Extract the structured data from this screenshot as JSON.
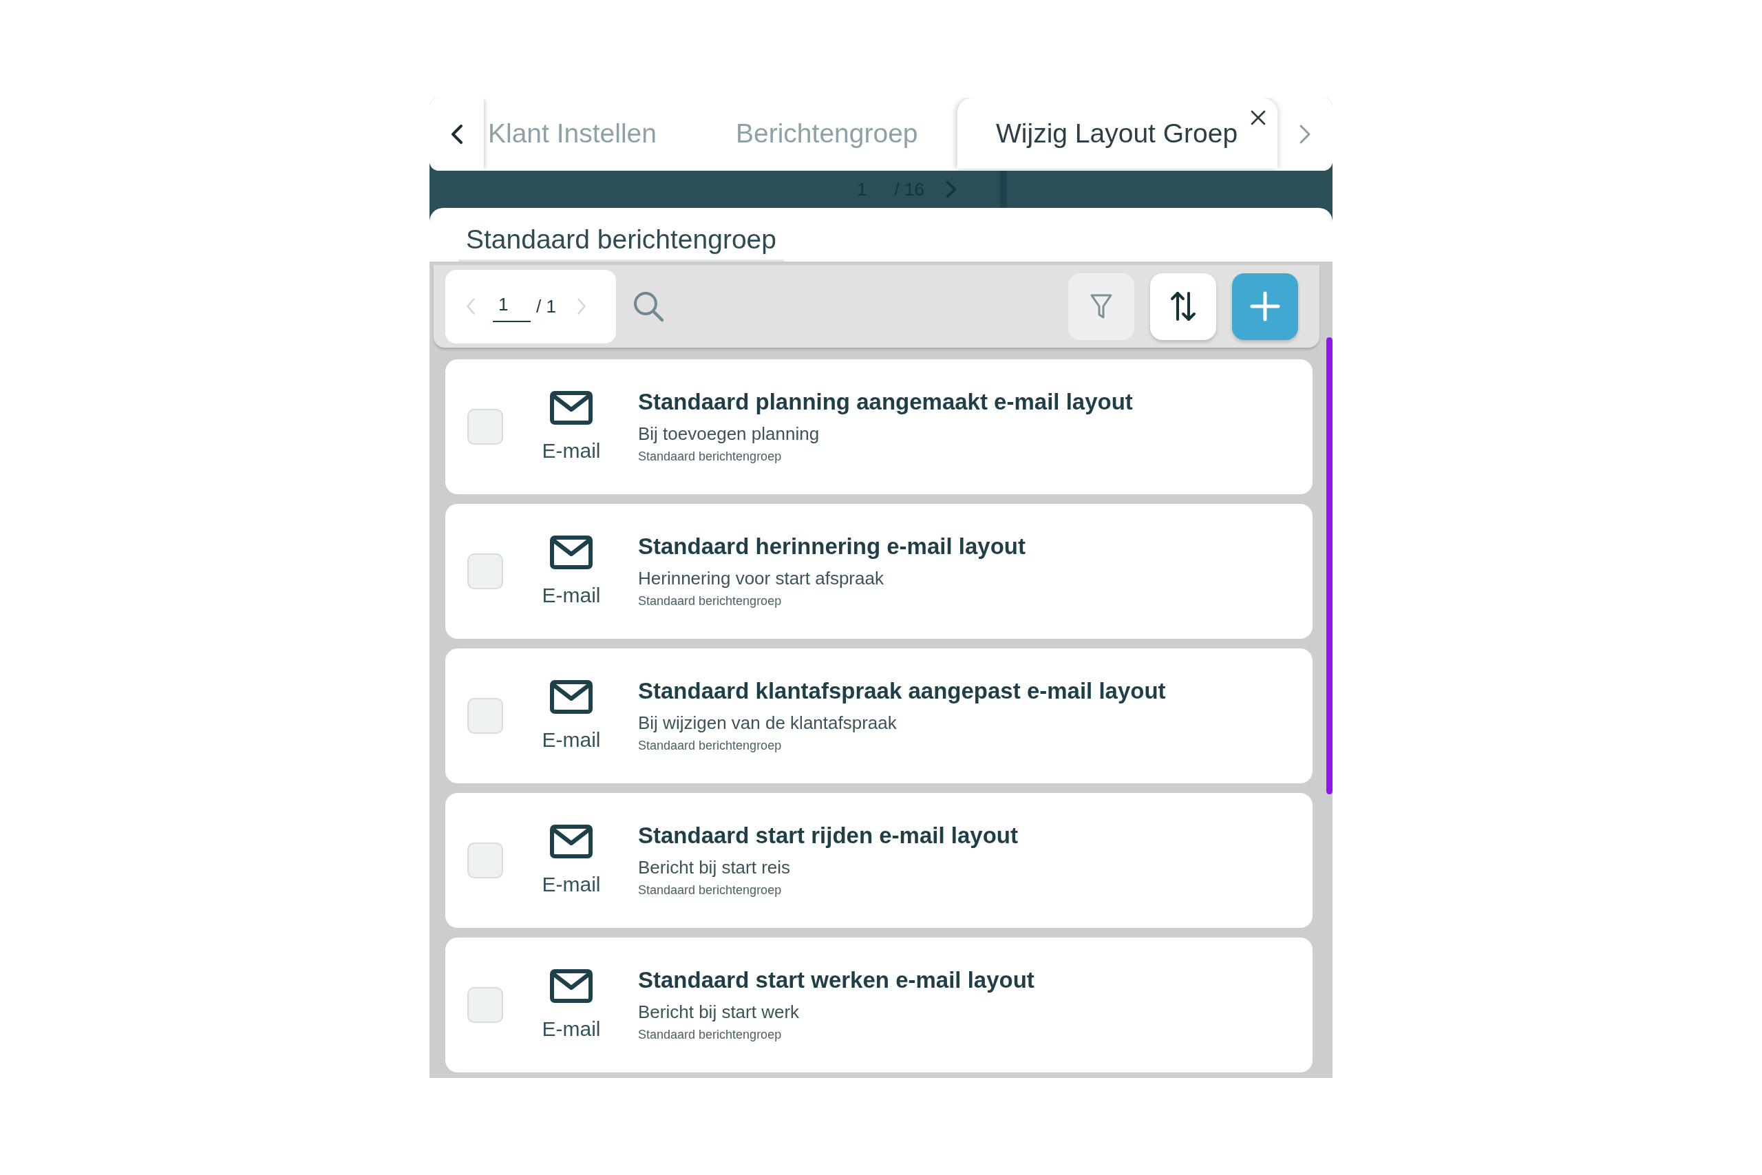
{
  "tabs": [
    {
      "label": "Klant Instellen",
      "selected": false
    },
    {
      "label": "Berichtengroep",
      "selected": false
    },
    {
      "label": "Wijzig Layout Groep",
      "selected": true
    }
  ],
  "background_pager": {
    "page": "1",
    "total": "/ 16"
  },
  "group_tab": {
    "label": "Standaard berichtengroep"
  },
  "toolbar": {
    "pager": {
      "page": "1",
      "total": "/ 1"
    },
    "buttons": [
      {
        "kind": "filter"
      },
      {
        "kind": "sort"
      },
      {
        "kind": "add"
      }
    ]
  },
  "messages": [
    {
      "checked": false,
      "channel": "E-mail",
      "title": "Standaard planning aangemaakt e-mail layout",
      "description": "Bij toevoegen planning",
      "group": "Standaard berichtengroep"
    },
    {
      "checked": false,
      "channel": "E-mail",
      "title": "Standaard herinnering e-mail layout",
      "description": "Herinnering voor start afspraak",
      "group": "Standaard berichtengroep"
    },
    {
      "checked": false,
      "channel": "E-mail",
      "title": "Standaard klantafspraak aangepast e-mail layout",
      "description": "Bij wijzigen van de klantafspraak",
      "group": "Standaard berichtengroep"
    },
    {
      "checked": false,
      "channel": "E-mail",
      "title": "Standaard start rijden e-mail layout",
      "description": "Bericht bij start reis",
      "group": "Standaard berichtengroep"
    },
    {
      "checked": false,
      "channel": "E-mail",
      "title": "Standaard start werken e-mail layout",
      "description": "Bericht bij start werk",
      "group": "Standaard berichtengroep"
    }
  ]
}
